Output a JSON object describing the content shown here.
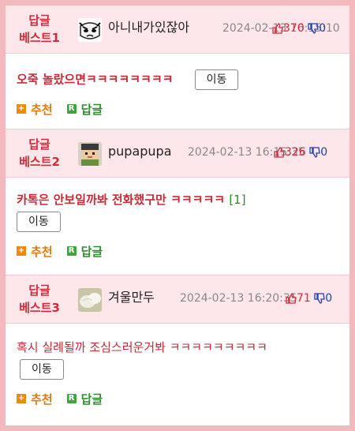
{
  "posts": [
    {
      "rank_line1": "답글",
      "rank_line2": "베스트1",
      "nickname": "아니내가있잖아",
      "date": "2024-02-13 16:15:10",
      "up": "370",
      "down": "0",
      "content": "오죽 놀랐으면ㅋㅋㅋㅋㅋㅋㅋㅋ",
      "reply_count": "",
      "move_label": "이동",
      "recommend_label": "추천",
      "reply_label": "답글",
      "avatar_icon": "cartoon-face-icon"
    },
    {
      "rank_line1": "답글",
      "rank_line2": "베스트2",
      "nickname": "pupapupa",
      "date": "2024-02-13 16:15:35",
      "up": "326",
      "down": "0",
      "content": "카톡은 안보일까봐 전화했구만 ㅋㅋㅋㅋㅋ",
      "reply_count": "[1]",
      "move_label": "이동",
      "recommend_label": "추천",
      "reply_label": "답글",
      "avatar_icon": "pixel-character-icon"
    },
    {
      "rank_line1": "답글",
      "rank_line2": "베스트3",
      "nickname": "겨울만두",
      "date": "2024-02-13 16:20:35",
      "up": "71",
      "down": "0",
      "content": "혹시 실례될까 조심스러운거봐 ㅋㅋㅋㅋㅋㅋㅋㅋㅋ",
      "reply_count": "",
      "move_label": "이동",
      "recommend_label": "추천",
      "reply_label": "답글",
      "avatar_icon": "dumpling-photo-icon"
    }
  ],
  "colors": {
    "accent_red": "#d42a3b",
    "header_bg": "#fde7ea",
    "frame_bg": "#f3b9bd",
    "recommend_orange": "#f08a0c",
    "reply_green": "#3ea43e",
    "down_blue": "#1a3fb5"
  }
}
